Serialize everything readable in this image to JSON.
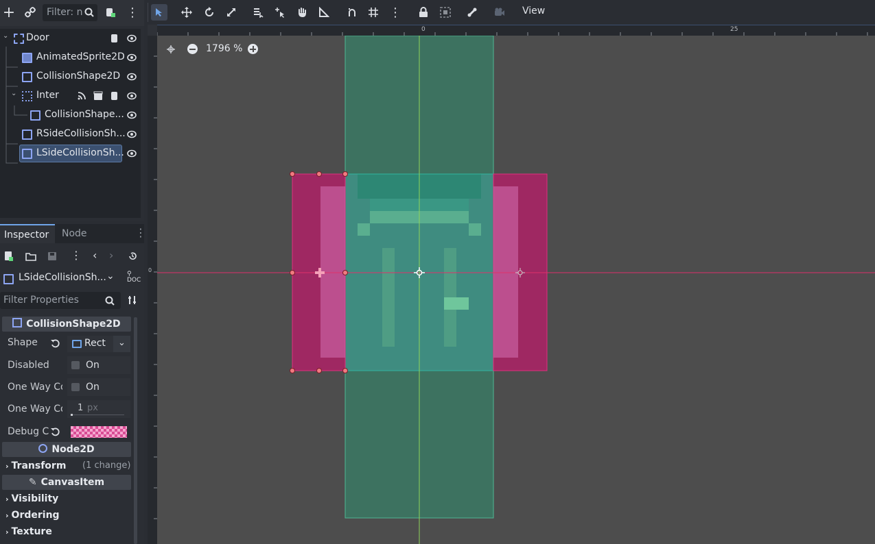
{
  "scene_toolbar": {
    "filter_placeholder": "Filter: n"
  },
  "scene_tree": {
    "nodes": [
      {
        "label": "Door"
      },
      {
        "label": "AnimatedSprite2D"
      },
      {
        "label": "CollisionShape2D"
      },
      {
        "label": "Inter"
      },
      {
        "label": "CollisionShape..."
      },
      {
        "label": "RSideCollisionSh..."
      },
      {
        "label": "LSideCollisionSh..."
      }
    ]
  },
  "inspector": {
    "tabs": [
      "Inspector",
      "Node"
    ],
    "selected_node": "LSideCollisionSh...",
    "filter_placeholder": "Filter Properties",
    "section_collision": "CollisionShape2D",
    "shape_label": "Shape",
    "shape_value": "Rect",
    "disabled_label": "Disabled",
    "disabled_value": "On",
    "oneway_label": "One Way Co",
    "oneway_value": "On",
    "oneway_margin_label": "One Way Co",
    "oneway_margin_value": "1",
    "oneway_margin_unit": "px",
    "debug_label": "Debug C",
    "section_node2d": "Node2D",
    "transform_label": "Transform",
    "transform_note": "(1 change)",
    "section_canvasitem": "CanvasItem",
    "visibility_label": "Visibility",
    "ordering_label": "Ordering",
    "texture_label": "Texture"
  },
  "toolbar": {
    "view_menu": "View"
  },
  "viewport": {
    "zoom": "1796 %",
    "ruler_top_labels": [
      "0",
      "25"
    ],
    "ruler_left_labels": [
      "0"
    ]
  },
  "colors": {
    "accent": "#70a5e9",
    "node_icon": "#8da5f3",
    "collision_pink": "#c2186b",
    "collision_teal": "#3aa08f",
    "viewport_bg": "#4d4d4d"
  }
}
